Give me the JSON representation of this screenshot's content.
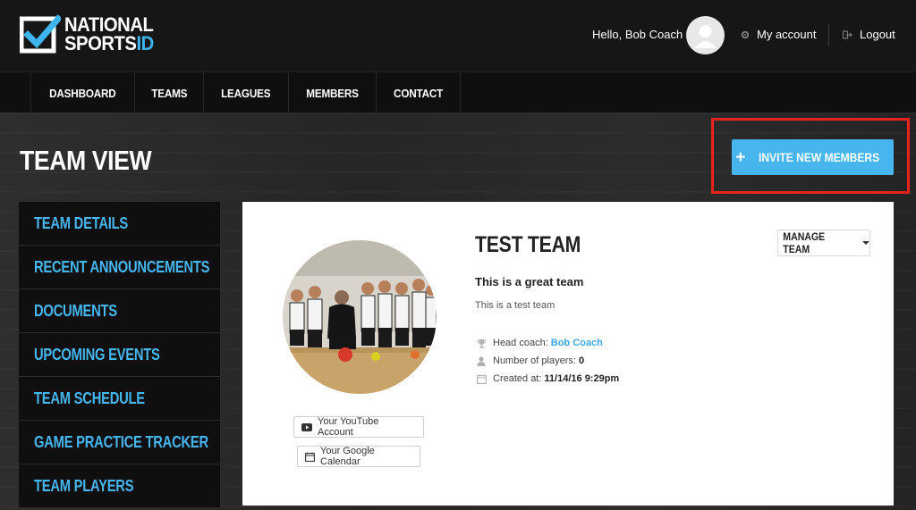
{
  "brand": {
    "line1": "NATIONAL",
    "line2_main": "SPORTS",
    "line2_accent": "ID",
    "accent_color": "#3fb5ef"
  },
  "header": {
    "greeting": "Hello, Bob Coach",
    "my_account": "My account",
    "logout": "Logout",
    "icons": {
      "account": "gear-icon",
      "logout": "logout-icon",
      "avatar": "user-avatar-icon"
    }
  },
  "nav": {
    "items": [
      {
        "label": "DASHBOARD"
      },
      {
        "label": "TEAMS"
      },
      {
        "label": "LEAGUES"
      },
      {
        "label": "MEMBERS"
      },
      {
        "label": "CONTACT"
      }
    ]
  },
  "page": {
    "title": "TEAM VIEW",
    "invite_button": "INVITE NEW MEMBERS",
    "invite_color": "#48b6ee",
    "highlight_color": "#e8231c"
  },
  "sidebar": {
    "items": [
      {
        "label": "TEAM DETAILS"
      },
      {
        "label": "RECENT ANNOUNCEMENTS"
      },
      {
        "label": "DOCUMENTS"
      },
      {
        "label": "UPCOMING EVENTS"
      },
      {
        "label": "TEAM SCHEDULE"
      },
      {
        "label": "GAME PRACTICE TRACKER"
      },
      {
        "label": "TEAM PLAYERS"
      }
    ]
  },
  "team": {
    "name": "TEST TEAM",
    "tagline": "This is a great team",
    "description": "This is a test team",
    "manage_button": "MANAGE TEAM",
    "head_coach_label": "Head coach:",
    "head_coach_value": "Bob Coach",
    "players_label": "Number of players:",
    "players_value": "0",
    "created_label": "Created at:",
    "created_value": "11/14/16 9:29pm",
    "youtube_button": "Your YouTube Account",
    "calendar_button": "Your Google Calendar"
  }
}
